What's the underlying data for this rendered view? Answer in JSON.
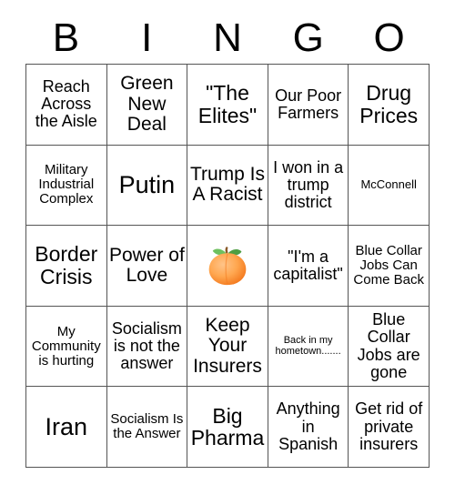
{
  "header": {
    "letters": [
      "B",
      "I",
      "N",
      "G",
      "O"
    ]
  },
  "grid": {
    "rows": 5,
    "columns": 5,
    "border_color": "#555555",
    "background_color": "#ffffff",
    "text_color": "#000000",
    "cells": [
      {
        "text": "Reach Across the Aisle",
        "size": "md",
        "type": "text"
      },
      {
        "text": "Green New Deal",
        "size": "lg",
        "type": "text"
      },
      {
        "text": "\"The Elites\"",
        "size": "xl",
        "type": "text"
      },
      {
        "text": "Our Poor Farmers",
        "size": "md",
        "type": "text"
      },
      {
        "text": "Drug Prices",
        "size": "xl",
        "type": "text"
      },
      {
        "text": "Military Industrial Complex",
        "size": "sm",
        "type": "text"
      },
      {
        "text": "Putin",
        "size": "xxl",
        "type": "text"
      },
      {
        "text": "Trump Is A Racist",
        "size": "lg",
        "type": "text"
      },
      {
        "text": "I won in a trump district",
        "size": "md",
        "type": "text"
      },
      {
        "text": "McConnell",
        "size": "xs",
        "type": "text"
      },
      {
        "text": "Border Crisis",
        "size": "xl",
        "type": "text"
      },
      {
        "text": "Power of Love",
        "size": "lg",
        "type": "text"
      },
      {
        "text": "",
        "size": "md",
        "type": "emoji",
        "emoji_name": "peach-emoji"
      },
      {
        "text": "\"I'm a capitalist\"",
        "size": "md",
        "type": "text"
      },
      {
        "text": "Blue Collar Jobs Can Come Back",
        "size": "sm",
        "type": "text"
      },
      {
        "text": "My Community is hurting",
        "size": "sm",
        "type": "text"
      },
      {
        "text": "Socialism is not the answer",
        "size": "md",
        "type": "text"
      },
      {
        "text": "Keep Your Insurers",
        "size": "lg",
        "type": "text"
      },
      {
        "text": "Back in my hometown.......",
        "size": "xxs",
        "type": "text"
      },
      {
        "text": "Blue Collar Jobs are gone",
        "size": "md",
        "type": "text"
      },
      {
        "text": "Iran",
        "size": "xxl",
        "type": "text"
      },
      {
        "text": "Socialism Is the Answer",
        "size": "sm",
        "type": "text"
      },
      {
        "text": "Big Pharma",
        "size": "xl",
        "type": "text"
      },
      {
        "text": "Anything in Spanish",
        "size": "md",
        "type": "text"
      },
      {
        "text": "Get rid of private insurers",
        "size": "md",
        "type": "text"
      }
    ]
  },
  "colors": {
    "peach_body_light": "#ffc489",
    "peach_body_mid": "#ffa750",
    "peach_body_dark": "#f47b20",
    "peach_leaf": "#6ec05f",
    "peach_leaf_dark": "#4e9e43",
    "peach_stem": "#8a5a29"
  }
}
